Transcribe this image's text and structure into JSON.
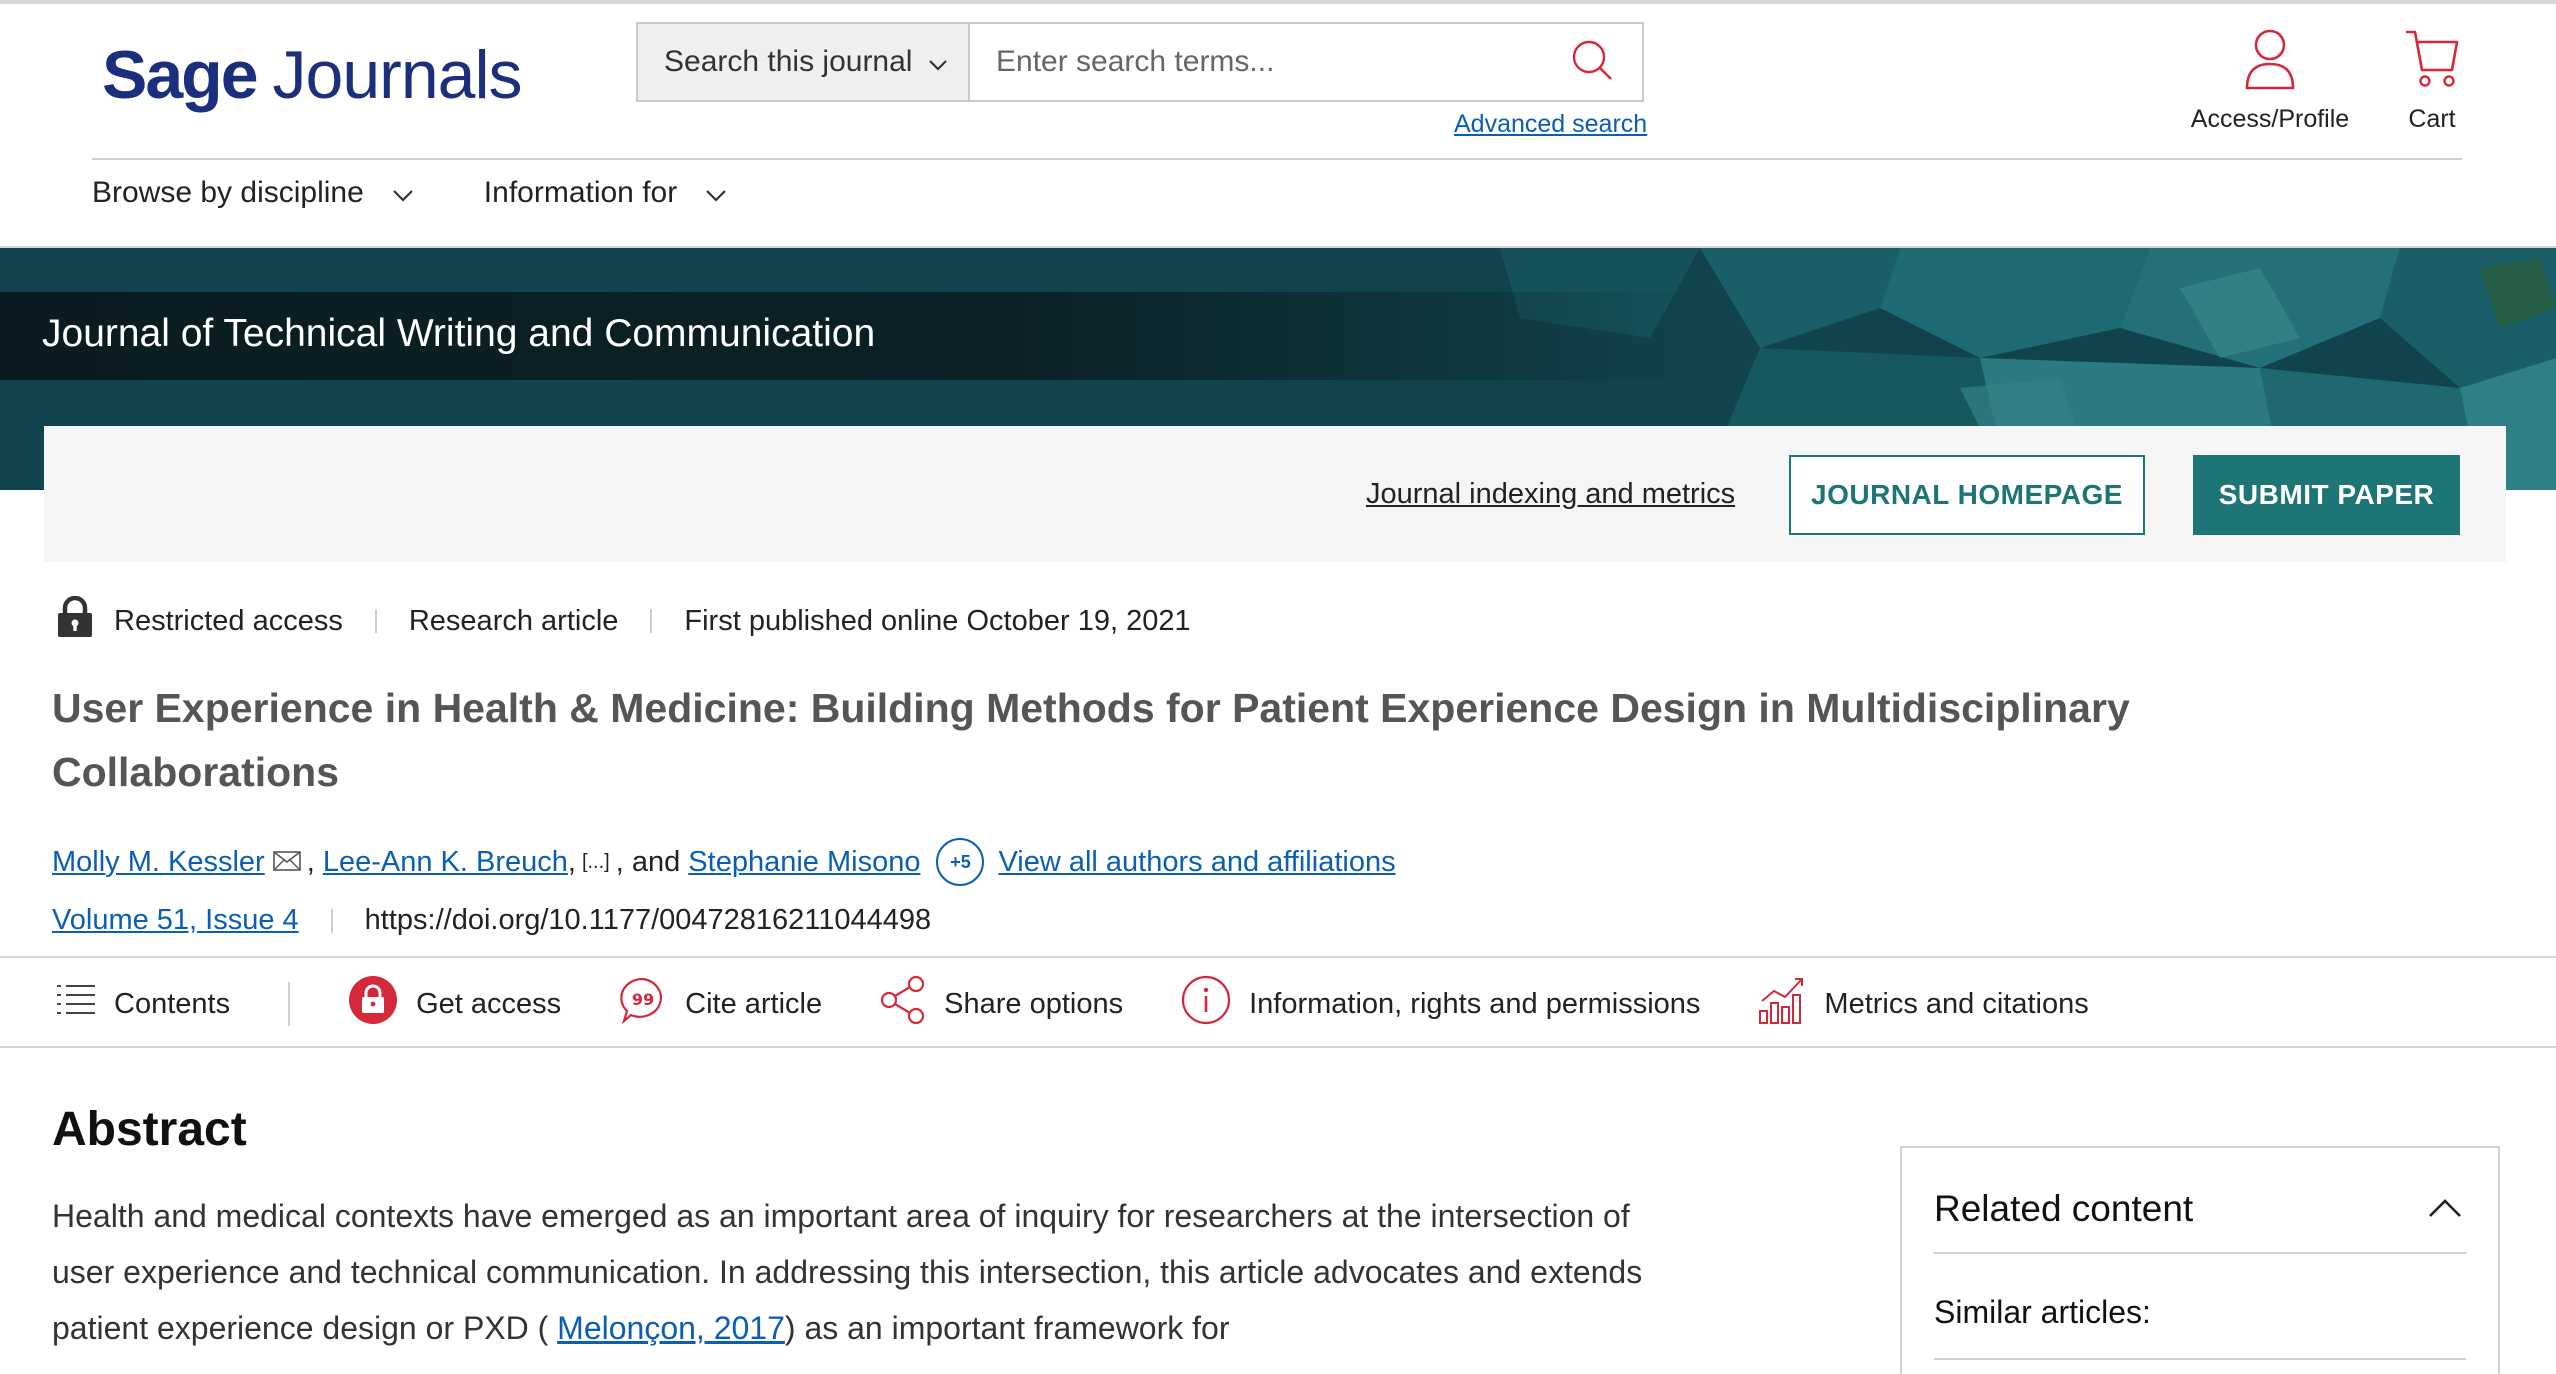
{
  "header": {
    "logo_part1": "Sage",
    "logo_part2": "Journals",
    "search_scope": "Search this journal",
    "search_placeholder": "Enter search terms...",
    "advanced_search": "Advanced search",
    "access_label": "Access/Profile",
    "cart_label": "Cart"
  },
  "nav": {
    "items": [
      {
        "label": "Browse by discipline"
      },
      {
        "label": "Information for"
      }
    ]
  },
  "journal": {
    "name": "Journal of Technical Writing and Communication",
    "indexing_link": "Journal indexing and metrics",
    "homepage_button": "JOURNAL HOMEPAGE",
    "submit_button": "SUBMIT PAPER"
  },
  "article": {
    "access": "Restricted access",
    "type": "Research article",
    "published": "First published online October 19, 2021",
    "title": "User Experience in Health & Medicine: Building Methods for Patient Experience Design in Multidisciplinary Collaborations",
    "authors": {
      "first": "Molly M. Kessler",
      "second": "Lee-Ann K. Breuch",
      "ellipsis": "[...]",
      "and": ", and",
      "last": "Stephanie Misono",
      "more_count": "+5",
      "view_all": "View all authors and affiliations"
    },
    "volume": "Volume 51, Issue 4",
    "doi": "https://doi.org/10.1177/00472816211044498"
  },
  "toolbar": {
    "contents": "Contents",
    "get_access": "Get access",
    "cite": "Cite article",
    "share": "Share options",
    "info": "Information, rights and permissions",
    "metrics": "Metrics and citations"
  },
  "abstract": {
    "heading": "Abstract",
    "text_before": "Health and medical contexts have emerged as an important area of inquiry for researchers at the intersection of user experience and technical communication. In addressing this intersection, this article advocates and extends patient experience design or PXD ( ",
    "citation": "Melonçon, 2017",
    "text_after": ") as an important framework for"
  },
  "related": {
    "heading": "Related content",
    "similar": "Similar articles:"
  },
  "colors": {
    "brand_navy": "#1b2f7d",
    "teal": "#1d7575",
    "link": "#0b5fb3",
    "icon_red": "#d3293b"
  }
}
